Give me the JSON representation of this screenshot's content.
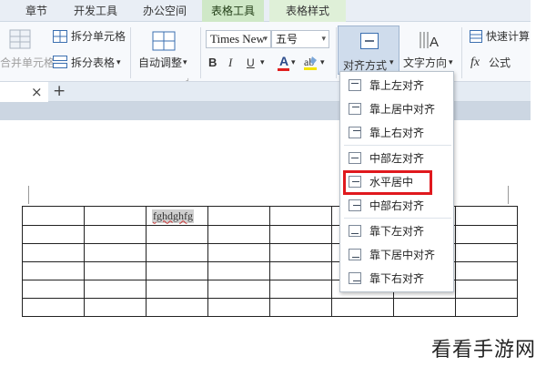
{
  "tabs": [
    "章节",
    "开发工具",
    "办公空间",
    "表格工具",
    "表格样式"
  ],
  "active_tab_index": 3,
  "ribbon": {
    "merge_label": "合并单元格",
    "split_cell_label": "拆分单元格",
    "split_table_label": "拆分表格",
    "split_table_arrow": "▾",
    "autofit_label": "自动调整",
    "autofit_arrow": "▾",
    "font_name": "Times New",
    "font_size": "五号",
    "bold": "B",
    "italic": "I",
    "underline": "U",
    "font_color": "A",
    "align_label": "对齐方式",
    "text_dir_label": "文字方向",
    "quick_calc_label": "快速计算",
    "formula_label": "公式",
    "formula_fx": "fx"
  },
  "document_tab": {
    "close": "×",
    "new_tab": "+"
  },
  "table": {
    "rows": 6,
    "cols": 8,
    "cell_text": "fghdghfg",
    "cell_row": 1,
    "cell_col": 3
  },
  "align_menu": {
    "items": [
      "靠上左对齐",
      "靠上居中对齐",
      "靠上右对齐",
      "中部左对齐",
      "水平居中",
      "中部右对齐",
      "靠下左对齐",
      "靠下居中对齐",
      "靠下右对齐"
    ],
    "highlighted_index": 4
  },
  "watermark": "看看手游网",
  "colors": {
    "active_tab": "#cfe8c7",
    "highlight_border": "#e0191e",
    "font_color_bar": "#e02020",
    "highlight_pen": "#f5e400"
  }
}
